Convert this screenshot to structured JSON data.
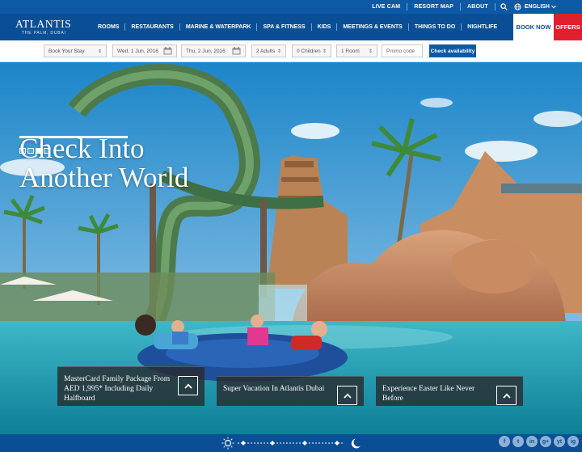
{
  "utility_bar": {
    "links": [
      "LIVE CAM",
      "RESORT MAP",
      "ABOUT"
    ],
    "language": "ENGLISH",
    "icons": [
      "search-icon",
      "globe-icon",
      "chevron-down-icon"
    ]
  },
  "brand": {
    "name": "ATLANTIS",
    "tagline": "THE PALM, DUBAI"
  },
  "nav": {
    "items": [
      "ROOMS",
      "RESTAURANTS",
      "MARINE & WATERPARK",
      "SPA & FITNESS",
      "KIDS",
      "MEETINGS & EVENTS",
      "THINGS TO DO",
      "NIGHTLIFE"
    ],
    "book_now": "BOOK NOW",
    "offers": "OFFERS"
  },
  "booking": {
    "stay_select": "Book Your Stay",
    "checkin": "Wed, 1 Jun, 2016",
    "checkout": "Thu, 2 Jun, 2016",
    "adults": "2 Adults",
    "children": "0 Children",
    "rooms": "1 Room",
    "promo_placeholder": "Promo code",
    "check_label": "Check availability"
  },
  "hero": {
    "title_line1": "Check Into",
    "title_line2": "Another World",
    "slide_count": 4,
    "active_slide": 3
  },
  "cards": [
    {
      "text": "MasterCard Family Package From AED 1,995* Including Daily Halfboard"
    },
    {
      "text": "Super Vacation In Atlantis Dubai"
    },
    {
      "text": "Experience Easter Like Never Before"
    }
  ],
  "footer": {
    "socials": [
      "f",
      "t",
      "in",
      "g+",
      "yt",
      "ig"
    ],
    "social_icons": [
      "facebook-icon",
      "twitter-icon",
      "linkedin-icon",
      "google-plus-icon",
      "youtube-icon",
      "instagram-icon"
    ]
  },
  "colors": {
    "brand_blue": "#0a4f95",
    "util_blue": "#0c5aa6",
    "offers_red": "#e0202e"
  }
}
